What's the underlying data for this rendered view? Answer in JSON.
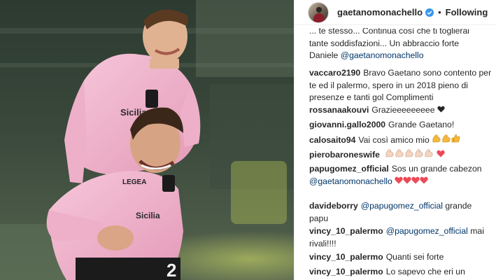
{
  "post": {
    "username": "gaetanomonachello",
    "separator": "•",
    "follow_label": "Following"
  },
  "icons": {
    "verified": "verified-badge-icon",
    "heart": "heart-icon",
    "flex": "flexed-biceps-icon",
    "thumbs": "thumbs-up-icon"
  },
  "colors": {
    "mention": "#003569",
    "heart_red": "#ed4956",
    "heart_black": "#262626",
    "jersey_pink": "#f2b6cf"
  },
  "comments": [
    {
      "lines": [
        "... te stesso... Continua così che ti toglierai",
        "tante soddisfazioni... Un abbraccio forte",
        "Daniele "
      ],
      "mention": "@gaetanomonachello"
    },
    {
      "user": "vaccaro2190",
      "text": "Bravo Gaetano sono contento per te ed il palermo, spero in un 2018 pieno di presenze e tanti gol Complimenti"
    },
    {
      "user": "rossanaakouvi",
      "text": "Grazieeeeeeeee"
    },
    {
      "user": "giovanni.gallo2000",
      "text": "Grande Gaetano!"
    },
    {
      "user": "calosaito94",
      "text": "Vai così amico mio"
    },
    {
      "user": "pierobaroneswife",
      "text": ""
    },
    {
      "user": "papugomez_official",
      "text": "Sos un grande cabezon",
      "mention": "@gaetanomonachello"
    },
    {
      "user": "davideborry",
      "mention": "@papugomez_official",
      "text": "grande papu"
    },
    {
      "user": "vincy_10_palermo",
      "mention": "@papugomez_official",
      "text": "mai rivali!!!!"
    },
    {
      "user": "vincy_10_palermo",
      "text": "Quanti sei forte"
    },
    {
      "user": "vincy_10_palermo",
      "text": "Lo sapevo che eri un"
    }
  ],
  "jersey": {
    "sponsor": "Sicilia",
    "brand": "LEGEA",
    "number": "2"
  }
}
